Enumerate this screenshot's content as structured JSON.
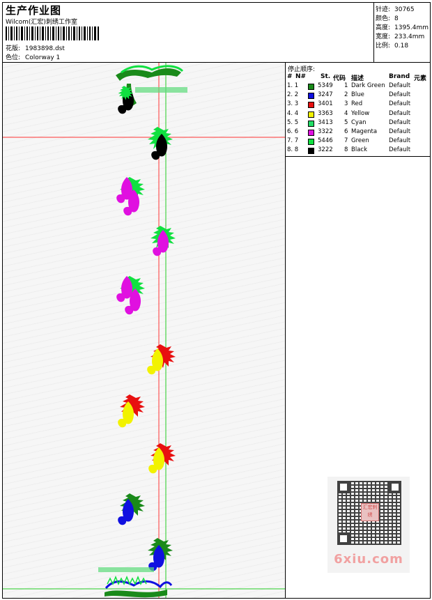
{
  "header": {
    "title": "生产作业图",
    "subtitle": "Wilcom(汇宏)刺绣工作室",
    "file_label": "花版:",
    "file_name": "1983898.dst",
    "colorway_label": "色位:",
    "colorway_name": "Colorway 1"
  },
  "stats": [
    {
      "label": "针迹:",
      "value": "30765"
    },
    {
      "label": "颜色:",
      "value": "8"
    },
    {
      "label": "高度:",
      "value": "1395.4mm"
    },
    {
      "label": "宽度:",
      "value": "233.4mm"
    },
    {
      "label": "比例:",
      "value": "0.18"
    }
  ],
  "stop_sequence": {
    "title": "停止顺序:",
    "columns": [
      "#",
      "N#",
      "St.",
      "代码",
      "描述",
      "Brand",
      "元素"
    ],
    "rows": [
      {
        "index": "1. 1",
        "color": "#1a8a1a",
        "stitches": "5349",
        "code": "1",
        "desc": "Dark Green",
        "brand": "Default"
      },
      {
        "index": "2. 2",
        "color": "#1010e0",
        "stitches": "3247",
        "code": "2",
        "desc": "Blue",
        "brand": "Default"
      },
      {
        "index": "3. 3",
        "color": "#e81010",
        "stitches": "3401",
        "code": "3",
        "desc": "Red",
        "brand": "Default"
      },
      {
        "index": "4. 4",
        "color": "#f2f200",
        "stitches": "3363",
        "code": "4",
        "desc": "Yellow",
        "brand": "Default"
      },
      {
        "index": "5. 5",
        "color": "#22dd66",
        "stitches": "3413",
        "code": "5",
        "desc": "Cyan",
        "brand": "Default"
      },
      {
        "index": "6. 6",
        "color": "#e010e0",
        "stitches": "3322",
        "code": "6",
        "desc": "Magenta",
        "brand": "Default"
      },
      {
        "index": "7. 7",
        "color": "#10e040",
        "stitches": "5446",
        "code": "7",
        "desc": "Green",
        "brand": "Default"
      },
      {
        "index": "8. 8",
        "color": "#000000",
        "stitches": "3222",
        "code": "8",
        "desc": "Black",
        "brand": "Default"
      }
    ]
  },
  "watermark": {
    "text": "6xiu.com",
    "stamp": "汇宏刺绣"
  }
}
